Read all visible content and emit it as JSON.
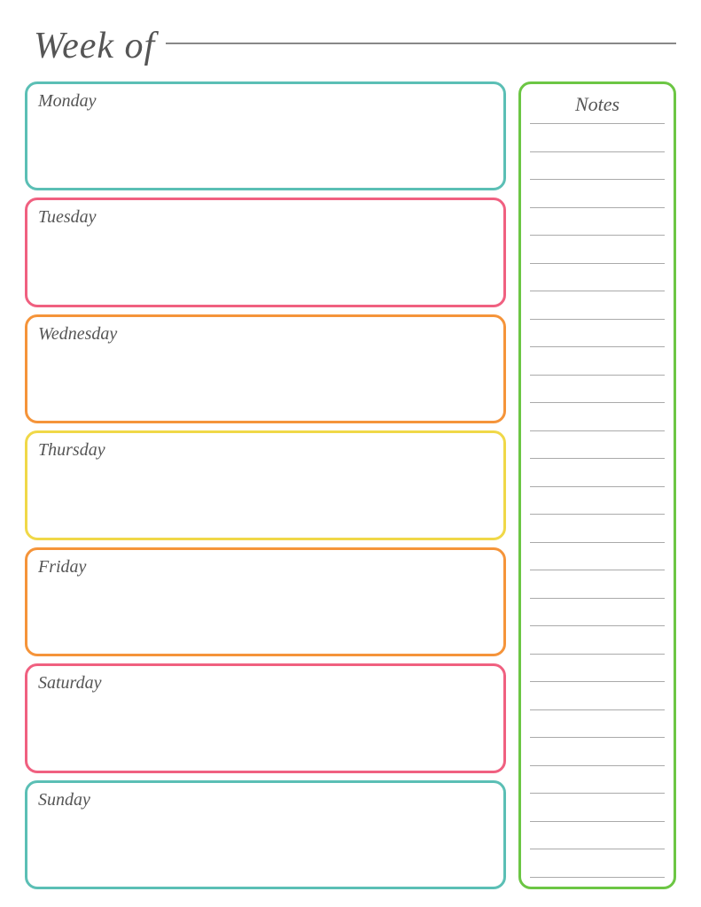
{
  "header": {
    "week_of_label": "Week of"
  },
  "days": [
    {
      "id": "monday",
      "label": "Monday",
      "color_class": "day-monday"
    },
    {
      "id": "tuesday",
      "label": "Tuesday",
      "color_class": "day-tuesday"
    },
    {
      "id": "wednesday",
      "label": "Wednesday",
      "color_class": "day-wednesday"
    },
    {
      "id": "thursday",
      "label": "Thursday",
      "color_class": "day-thursday"
    },
    {
      "id": "friday",
      "label": "Friday",
      "color_class": "day-friday"
    },
    {
      "id": "saturday",
      "label": "Saturday",
      "color_class": "day-saturday"
    },
    {
      "id": "sunday",
      "label": "Sunday",
      "color_class": "day-sunday"
    }
  ],
  "notes": {
    "title": "Notes",
    "line_count": 28
  }
}
